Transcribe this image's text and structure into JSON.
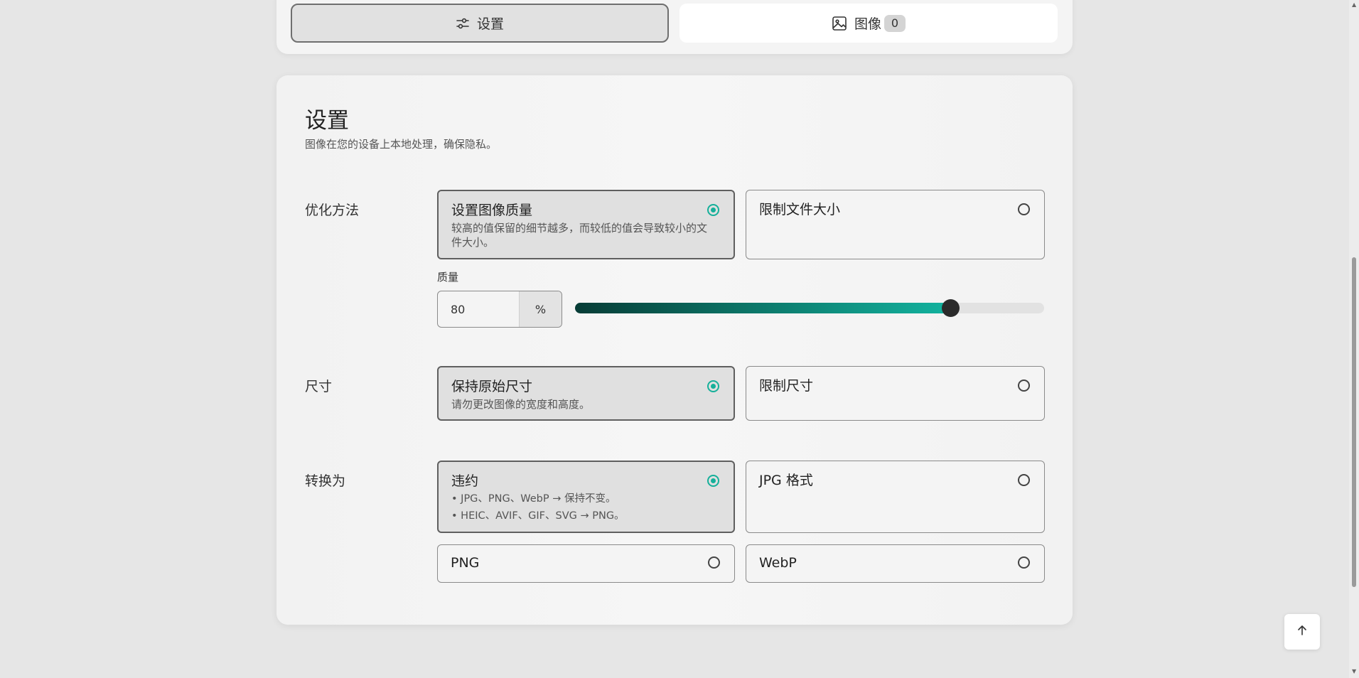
{
  "tabs": [
    {
      "label": "设置",
      "icon": "sliders-icon"
    },
    {
      "label": "图像",
      "icon": "image-icon",
      "count": "0"
    }
  ],
  "settings": {
    "title": "设置",
    "description": "图像在您的设备上本地处理，确保隐私。"
  },
  "optimization": {
    "label": "优化方法",
    "options": [
      {
        "title": "设置图像质量",
        "desc": "较高的值保留的细节越多，而较低的值会导致较小的文件大小。",
        "selected": true
      },
      {
        "title": "限制文件大小",
        "desc": "",
        "selected": false
      }
    ],
    "quality_label": "质量",
    "quality_value": "80",
    "quality_unit": "%",
    "quality_level": 0.8
  },
  "size": {
    "label": "尺寸",
    "options": [
      {
        "title": "保持原始尺寸",
        "desc": "请勿更改图像的宽度和高度。",
        "selected": true
      },
      {
        "title": "限制尺寸",
        "desc": "",
        "selected": false
      }
    ]
  },
  "convert": {
    "label": "转换为",
    "options": [
      {
        "title": "违约",
        "lines": [
          "• JPG、PNG、WebP → 保持不变。",
          "• HEIC、AVIF、GIF、SVG → PNG。"
        ],
        "selected": true
      },
      {
        "title": "JPG 格式",
        "selected": false
      },
      {
        "title": "PNG",
        "selected": false
      },
      {
        "title": "WebP",
        "selected": false
      }
    ]
  },
  "colors": {
    "accent": "#16b09a",
    "slider_start": "#073c36",
    "slider_end": "#13b39f"
  }
}
